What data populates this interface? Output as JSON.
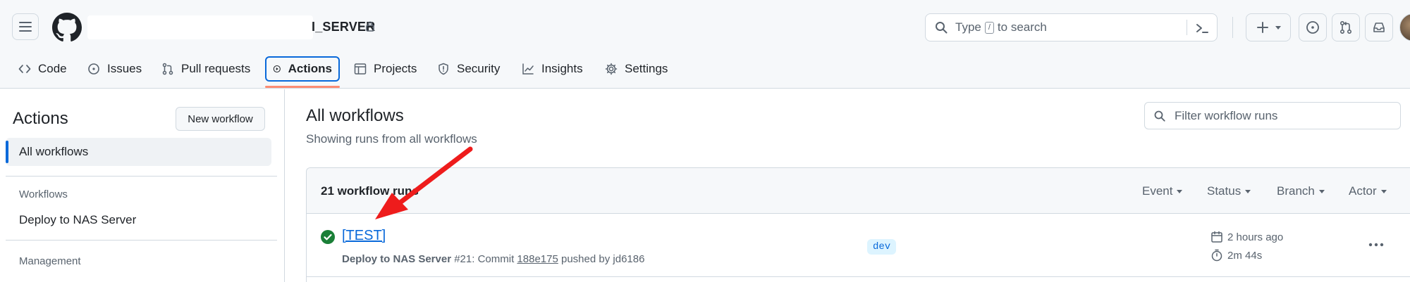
{
  "header": {
    "repo_name": "I_SERVER",
    "search_placeholder_before": "Type",
    "search_key": "/",
    "search_placeholder_after": "to search"
  },
  "nav": {
    "items": [
      {
        "label": "Code",
        "icon": "code-icon"
      },
      {
        "label": "Issues",
        "icon": "issue-icon"
      },
      {
        "label": "Pull requests",
        "icon": "pull-request-icon"
      },
      {
        "label": "Actions",
        "icon": "play-icon",
        "active": true
      },
      {
        "label": "Projects",
        "icon": "table-icon"
      },
      {
        "label": "Security",
        "icon": "shield-icon"
      },
      {
        "label": "Insights",
        "icon": "graph-icon"
      },
      {
        "label": "Settings",
        "icon": "gear-icon"
      }
    ]
  },
  "sidebar": {
    "title": "Actions",
    "new_workflow_label": "New workflow",
    "all_workflows_label": "All workflows",
    "workflows_heading": "Workflows",
    "workflow_item": "Deploy to NAS Server",
    "management_heading": "Management"
  },
  "main": {
    "title": "All workflows",
    "subtitle": "Showing runs from all workflows",
    "filter_placeholder": "Filter workflow runs",
    "runs_count": "21 workflow runs",
    "filters": [
      "Event",
      "Status",
      "Branch",
      "Actor"
    ]
  },
  "run": {
    "title": "[TEST]",
    "workflow": "Deploy to NAS Server",
    "run_number": "#21: Commit",
    "sha": "188e175",
    "pushed_by": "pushed by jd6186",
    "branch": "dev",
    "time_ago": "2 hours ago",
    "duration": "2m 44s",
    "status": "success"
  },
  "colors": {
    "accent": "#0969da",
    "success": "#1a7f37",
    "annotation_arrow": "#ee1c1c",
    "nav_underline": "#fd8c73"
  }
}
